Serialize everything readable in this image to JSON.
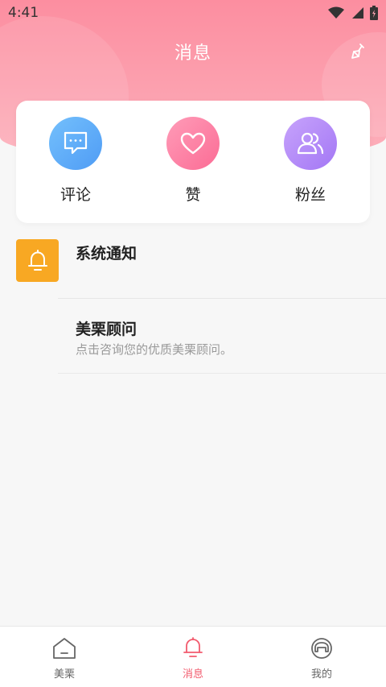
{
  "status_bar": {
    "time": "4:41"
  },
  "header": {
    "title": "消息"
  },
  "quick_actions": [
    {
      "label": "评论",
      "icon": "comment-icon"
    },
    {
      "label": "赞",
      "icon": "heart-icon"
    },
    {
      "label": "粉丝",
      "icon": "fans-icon"
    }
  ],
  "messages": {
    "system_notice": {
      "title": "系统通知",
      "icon": "bell-icon"
    },
    "advisor": {
      "title": "美栗顾问",
      "subtitle": "点击咨询您的优质美栗顾问。"
    }
  },
  "bottom_nav": [
    {
      "label": "美栗",
      "icon": "home-icon",
      "active": false
    },
    {
      "label": "消息",
      "icon": "bell-icon",
      "active": true
    },
    {
      "label": "我的",
      "icon": "profile-icon",
      "active": false
    }
  ],
  "colors": {
    "accent": "#f25b6e",
    "header": "#fc8ea0",
    "notice": "#f8a823"
  }
}
